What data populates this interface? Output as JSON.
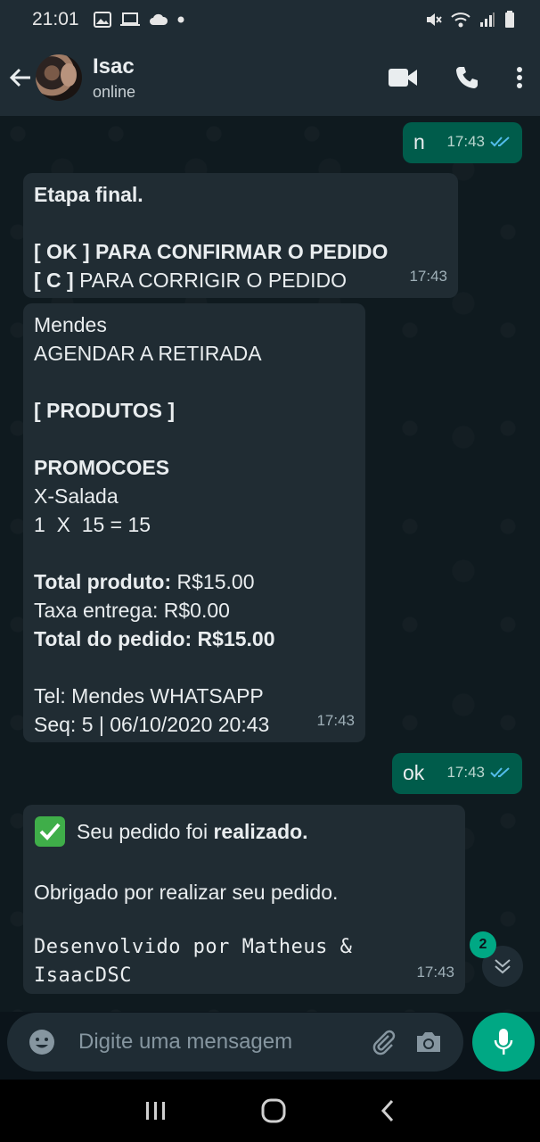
{
  "status_bar": {
    "time": "21:01"
  },
  "header": {
    "contact_name": "Isac",
    "contact_status": "online"
  },
  "messages": [
    {
      "side": "out",
      "lines": [
        "n"
      ],
      "time": "17:43"
    },
    {
      "side": "in",
      "lines": [
        "Etapa final.",
        "",
        "[ OK ] PARA CONFIRMAR O PEDIDO",
        "[ C ] PARA CORRIGIR O PEDIDO"
      ],
      "time": "17:43"
    },
    {
      "side": "in",
      "lines": [
        "Mendes",
        "AGENDAR A RETIRADA",
        "",
        "[ PRODUTOS ]",
        "",
        "PROMOCOES",
        "X-Salada",
        "1  X  15 = 15",
        "",
        "Total produto: R$15.00",
        "Taxa entrega: R$0.00",
        "Total do pedido: R$15.00",
        "",
        "Tel: Mendes WHATSAPP",
        "Seq: 5 | 06/10/2020 20:43"
      ],
      "time": "17:43"
    },
    {
      "side": "out",
      "lines": [
        "ok"
      ],
      "time": "17:43"
    },
    {
      "side": "in",
      "lines": [
        "Seu pedido foi",
        "realizado.",
        "Obrigado por realizar seu pedido.",
        "Desenvolvido por Matheus &",
        "IsaacDSC"
      ],
      "time": "17:43"
    }
  ],
  "unread_count": "2",
  "composer": {
    "placeholder": "Digite uma mensagem"
  },
  "colors": {
    "accent": "#00a884",
    "outgoing_bubble": "#005c4b",
    "incoming_bubble": "#202c33",
    "read_ticks": "#53bdeb"
  }
}
